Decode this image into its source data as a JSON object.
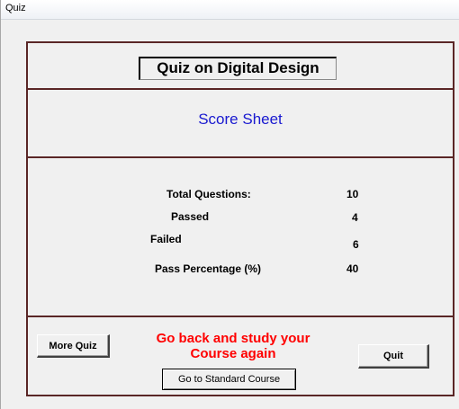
{
  "window": {
    "title": "Quiz"
  },
  "header": {
    "title": "Quiz on Digital Design"
  },
  "section": {
    "title": "Score Sheet"
  },
  "stats": {
    "total_label": "Total Questions:",
    "total_value": "10",
    "passed_label": "Passed",
    "passed_value": "4",
    "failed_label": "Failed",
    "failed_value": "6",
    "percentage_label": "Pass Percentage (%)",
    "percentage_value": "40"
  },
  "footer": {
    "message_line1": "Go back and study your",
    "message_line2": "Course again",
    "more_quiz_label": "More Quiz",
    "quit_label": "Quit",
    "standard_course_label": "Go to Standard Course"
  },
  "colors": {
    "frame": "#5a2626",
    "score_sheet_text": "#1a1ad0",
    "message_text": "#ff0000"
  }
}
